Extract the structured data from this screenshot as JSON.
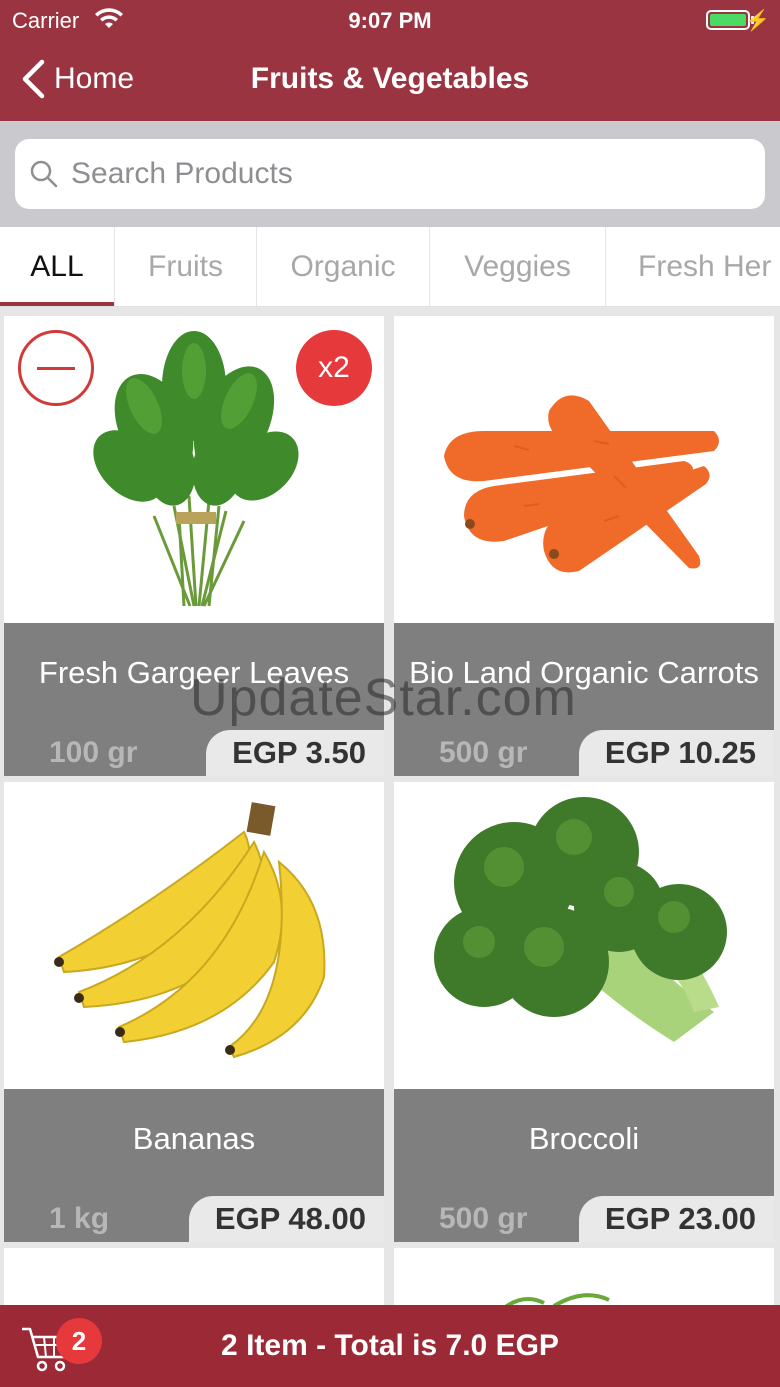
{
  "status_bar": {
    "carrier": "Carrier",
    "time": "9:07 PM"
  },
  "nav": {
    "back_label": "Home",
    "title": "Fruits & Vegetables"
  },
  "search": {
    "placeholder": "Search Products"
  },
  "tabs": [
    {
      "label": "ALL",
      "active": true
    },
    {
      "label": "Fruits",
      "active": false
    },
    {
      "label": "Organic",
      "active": false
    },
    {
      "label": "Veggies",
      "active": false
    },
    {
      "label": "Fresh Her",
      "active": false
    }
  ],
  "products": [
    {
      "name": "Fresh Gargeer Leaves",
      "weight": "100 gr",
      "price": "EGP 3.50",
      "quantity_badge": "x2",
      "icon": "gargeer-leaves-image"
    },
    {
      "name": "Bio Land Organic Carrots",
      "weight": "500 gr",
      "price": "EGP 10.25",
      "icon": "carrots-image"
    },
    {
      "name": "Bananas",
      "weight": "1 kg",
      "price": "EGP 48.00",
      "icon": "bananas-image"
    },
    {
      "name": "Broccoli",
      "weight": "500 gr",
      "price": "EGP 23.00",
      "icon": "broccoli-image"
    }
  ],
  "watermark": "UpdateStar.com",
  "cart": {
    "badge_count": "2",
    "summary": "2  Item - Total is  7.0 EGP"
  },
  "colors": {
    "brand": "#9b3441",
    "bottom_bar": "#9b2a36",
    "badge": "#e5393b",
    "info_panel": "#7f7f7f"
  }
}
